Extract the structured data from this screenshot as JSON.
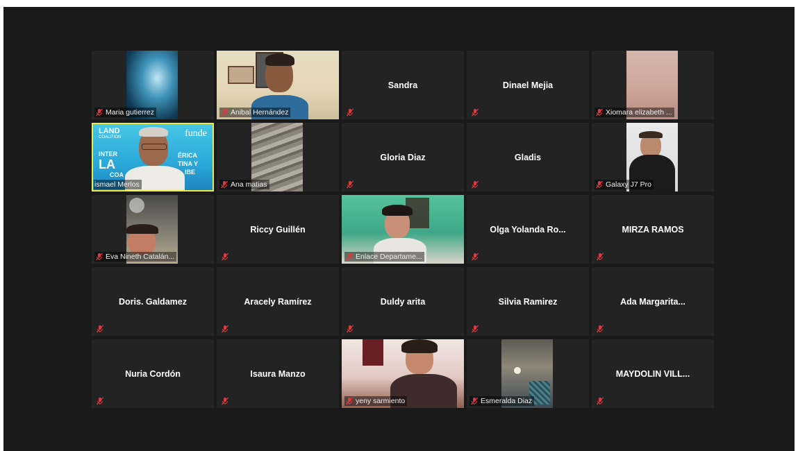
{
  "meeting": {
    "participants": [
      {
        "name": "Maria gutierrez",
        "video": true,
        "muted": true
      },
      {
        "name": "Anibal Hernández",
        "video": true,
        "muted": true
      },
      {
        "name": "Sandra",
        "video": false,
        "muted": true
      },
      {
        "name": "Dinael Mejia",
        "video": false,
        "muted": true
      },
      {
        "name": "Xiomara elizabeth ...",
        "video": true,
        "muted": true
      },
      {
        "name": "ismael Merlos",
        "video": true,
        "muted": false,
        "active_speaker": true
      },
      {
        "name": "Ana matias",
        "video": true,
        "muted": true
      },
      {
        "name": "Gloria Diaz",
        "video": false,
        "muted": true
      },
      {
        "name": "Gladis",
        "video": false,
        "muted": true
      },
      {
        "name": "Galaxy J7 Pro",
        "video": true,
        "muted": true
      },
      {
        "name": "Eva Nineth Catalán...",
        "video": true,
        "muted": true
      },
      {
        "name": "Riccy Guillén",
        "video": false,
        "muted": true
      },
      {
        "name": "Enlace Departame...",
        "video": true,
        "muted": true
      },
      {
        "name": "Olga Yolanda Ro...",
        "video": false,
        "muted": true
      },
      {
        "name": "MIRZA RAMOS",
        "video": false,
        "muted": true
      },
      {
        "name": "Doris. Galdamez",
        "video": false,
        "muted": true
      },
      {
        "name": "Aracely Ramírez",
        "video": false,
        "muted": true
      },
      {
        "name": "Duldy arita",
        "video": false,
        "muted": true
      },
      {
        "name": "Silvia Ramirez",
        "video": false,
        "muted": true
      },
      {
        "name": "Ada Margarita...",
        "video": false,
        "muted": true
      },
      {
        "name": "Nuria Cordón",
        "video": false,
        "muted": true
      },
      {
        "name": "Isaura Manzo",
        "video": false,
        "muted": true
      },
      {
        "name": "yeny sarmiento",
        "video": true,
        "muted": true
      },
      {
        "name": "Esmeralda Diaz",
        "video": true,
        "muted": true
      },
      {
        "name": "MAYDOLIN VILL...",
        "video": false,
        "muted": true
      }
    ],
    "speaker_banner_text": {
      "land_logo": "LAND",
      "land_sub": "COALITION",
      "funde_logo": "funde",
      "banner_words": [
        "INTER",
        "ÉRICA",
        "LA",
        "TINA Y",
        "COA",
        "IBE"
      ]
    },
    "colors": {
      "active_speaker_border": "#e6ef4a",
      "muted_icon": "#e0383e",
      "tile_bg": "#232323",
      "stage_bg": "#1a1a1a"
    }
  }
}
